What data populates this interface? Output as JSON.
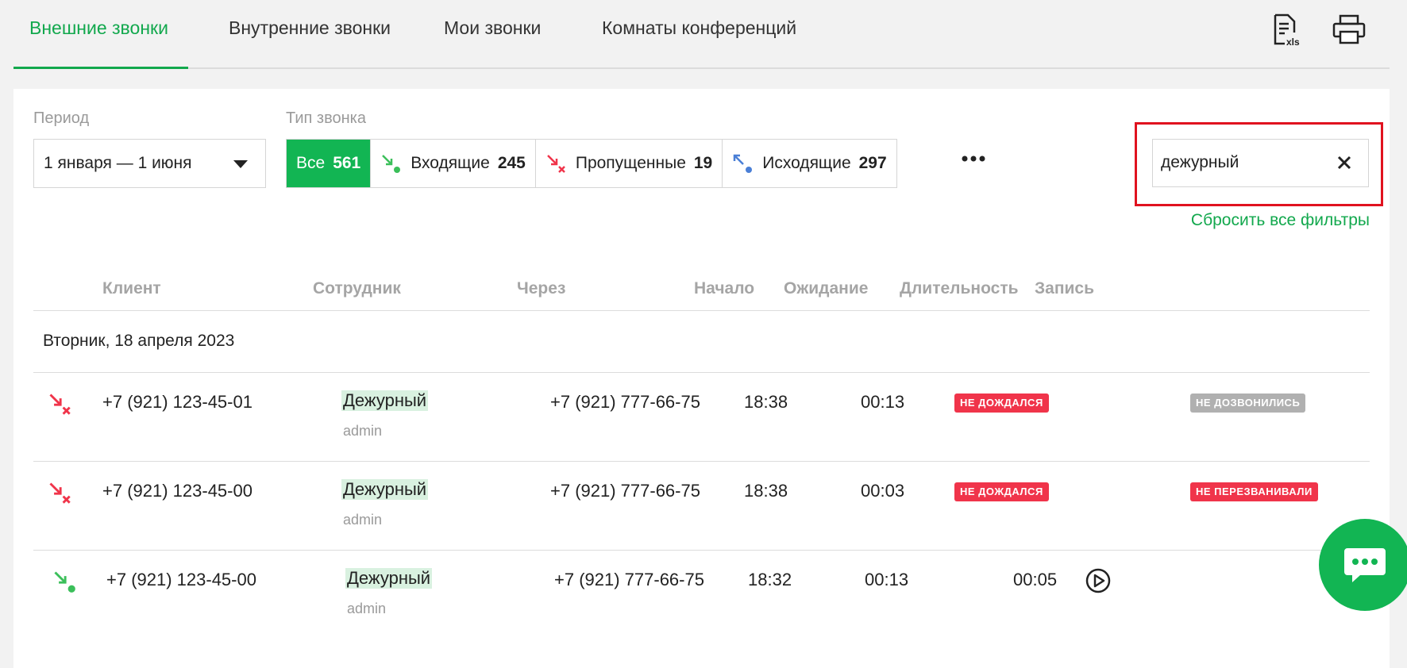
{
  "tabs": [
    {
      "label": "Внешние звонки",
      "active": true
    },
    {
      "label": "Внутренние звонки",
      "active": false
    },
    {
      "label": "Мои звонки",
      "active": false
    },
    {
      "label": "Комнаты конференций",
      "active": false
    }
  ],
  "toolbar": {
    "export_icon": "xls-export-icon",
    "print_icon": "printer-icon"
  },
  "filters": {
    "period_label": "Период",
    "period_value": "1 января — 1 июня",
    "type_label": "Тип звонка",
    "types": [
      {
        "label": "Все",
        "count": "561",
        "icon": ""
      },
      {
        "label": "Входящие",
        "count": "245",
        "icon": "incoming-call-icon"
      },
      {
        "label": "Пропущенные",
        "count": "19",
        "icon": "missed-call-icon"
      },
      {
        "label": "Исходящие",
        "count": "297",
        "icon": "outgoing-call-icon"
      }
    ],
    "search_value": "дежурный",
    "reset_label": "Сбросить все фильтры"
  },
  "table": {
    "headers": [
      "Клиент",
      "Сотрудник",
      "Через",
      "Начало",
      "Ожидание",
      "Длительность",
      "Запись"
    ],
    "date_group": "Вторник, 18 апреля 2023",
    "rows": [
      {
        "type": "missed",
        "client": "+7 (921) 123-45-01",
        "employee": "Дежурный",
        "role": "admin",
        "via": "+7 (921) 777-66-75",
        "start": "18:38",
        "wait": "00:13",
        "status": "НЕ ДОЖДАЛСЯ",
        "result": "НЕ ДОЗВОНИЛИСЬ"
      },
      {
        "type": "missed",
        "client": "+7 (921) 123-45-00",
        "employee": "Дежурный",
        "role": "admin",
        "via": "+7 (921) 777-66-75",
        "start": "18:38",
        "wait": "00:03",
        "status": "НЕ ДОЖДАЛСЯ",
        "result": "НЕ ПЕРЕЗВАНИВАЛИ"
      },
      {
        "type": "incoming",
        "client": "+7 (921) 123-45-00",
        "employee": "Дежурный",
        "role": "admin",
        "via": "+7 (921) 777-66-75",
        "start": "18:32",
        "wait": "00:13",
        "duration": "00:05",
        "recording": "play-icon"
      }
    ]
  },
  "colors": {
    "accent": "#12b553",
    "missed": "#f0344a",
    "outgoing": "#4a7fd6",
    "highlight": "#e0121f"
  }
}
